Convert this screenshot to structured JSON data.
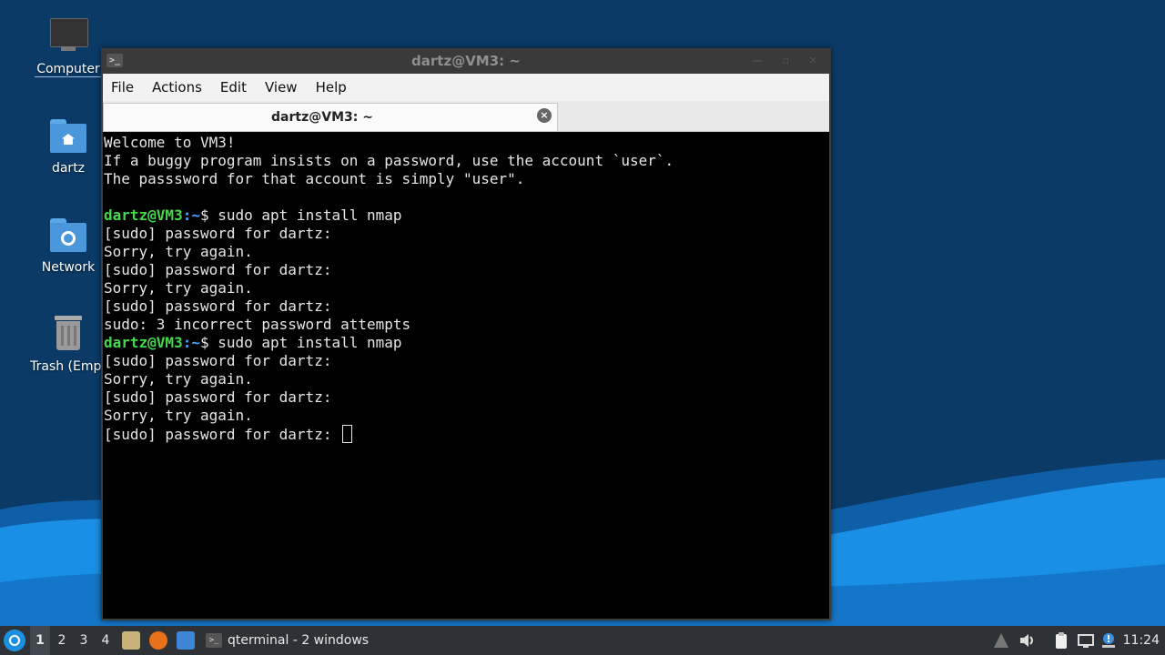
{
  "colors": {
    "desktop_dark": "#0b3a66",
    "wallpaper_wave": "#1a8fe6",
    "terminal_bg": "#000000",
    "prompt_user": "#44d94a",
    "prompt_path": "#4aa3ff",
    "taskbar_bg": "#2e3236"
  },
  "desktop": {
    "icons": [
      {
        "label": "Computer",
        "icon": "computer-icon"
      },
      {
        "label": "dartz",
        "icon": "home-folder-icon"
      },
      {
        "label": "Network",
        "icon": "network-folder-icon"
      },
      {
        "label": "Trash (Empt",
        "icon": "trash-icon"
      }
    ]
  },
  "window": {
    "title": "dartz@VM3: ~",
    "menu": [
      "File",
      "Actions",
      "Edit",
      "View",
      "Help"
    ],
    "tab_label": "dartz@VM3: ~"
  },
  "terminal": {
    "prompt_user": "dartz@VM3",
    "prompt_path": ":~",
    "prompt_symbol": "$ ",
    "lines": [
      {
        "text": "Welcome to VM3!"
      },
      {
        "text": "If a buggy program insists on a password, use the account `user`."
      },
      {
        "text": "The passsword for that account is simply \"user\"."
      },
      {
        "text": ""
      },
      {
        "prompt": true,
        "text": "sudo apt install nmap"
      },
      {
        "text": "[sudo] password for dartz:"
      },
      {
        "text": "Sorry, try again."
      },
      {
        "text": "[sudo] password for dartz:"
      },
      {
        "text": "Sorry, try again."
      },
      {
        "text": "[sudo] password for dartz:"
      },
      {
        "text": "sudo: 3 incorrect password attempts"
      },
      {
        "prompt": true,
        "text": "sudo apt install nmap"
      },
      {
        "text": "[sudo] password for dartz:"
      },
      {
        "text": "Sorry, try again."
      },
      {
        "text": "[sudo] password for dartz:"
      },
      {
        "text": "Sorry, try again."
      },
      {
        "text": "[sudo] password for dartz: ",
        "cursor": true
      }
    ]
  },
  "taskbar": {
    "workspaces": [
      "1",
      "2",
      "3",
      "4"
    ],
    "active_workspace": "1",
    "task_label": "qterminal - 2 windows",
    "clock": "11:24"
  }
}
